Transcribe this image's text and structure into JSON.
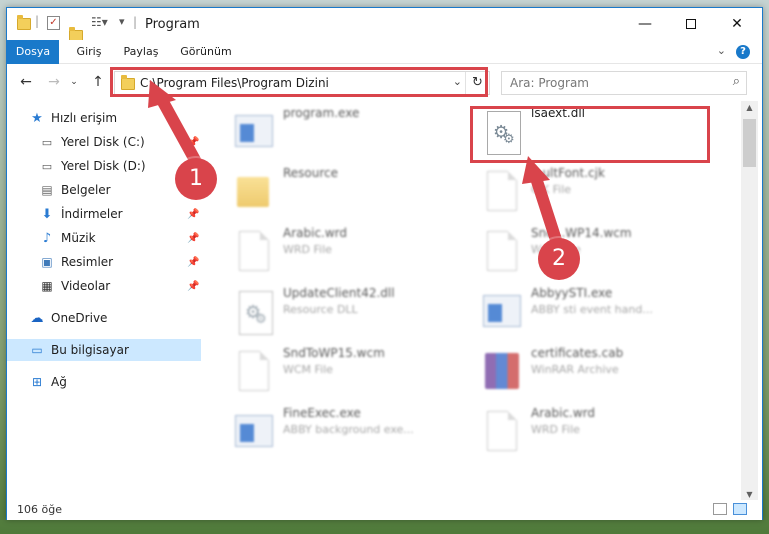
{
  "window": {
    "title": "Program",
    "minimize_icon": "minimize-icon",
    "maximize_icon": "maximize-icon",
    "close_icon": "close-icon"
  },
  "ribbon": {
    "tabs": [
      {
        "label": "Dosya",
        "active": true
      },
      {
        "label": "Giriş"
      },
      {
        "label": "Paylaş"
      },
      {
        "label": "Görünüm"
      }
    ],
    "help": "?"
  },
  "address": {
    "path": "C:\\Program Files\\Program Dizini",
    "search_placeholder": "Ara: Program"
  },
  "sidebar": {
    "items": [
      {
        "label": "Hızlı erişim",
        "icon": "star-icon"
      },
      {
        "label": "Yerel Disk (C:)",
        "icon": "drive-icon",
        "pinned": true
      },
      {
        "label": "Yerel Disk (D:)",
        "icon": "drive-icon"
      },
      {
        "label": "Belgeler",
        "icon": "documents-icon"
      },
      {
        "label": "İndirmeler",
        "icon": "download-icon",
        "pinned": true
      },
      {
        "label": "Müzik",
        "icon": "music-icon",
        "pinned": true
      },
      {
        "label": "Resimler",
        "icon": "pictures-icon",
        "pinned": true
      },
      {
        "label": "Videolar",
        "icon": "videos-icon",
        "pinned": true
      },
      {
        "label": "OneDrive",
        "icon": "cloud-icon"
      },
      {
        "label": "Bu bilgisayar",
        "icon": "computer-icon",
        "selected": true
      },
      {
        "label": "Ağ",
        "icon": "network-icon"
      }
    ]
  },
  "files": [
    {
      "name": "program.exe",
      "type": "",
      "icon": "application-icon"
    },
    {
      "name": "lsaext.dll",
      "type": "",
      "icon": "dll-gear-icon"
    },
    {
      "name": "Resource",
      "type": "",
      "icon": "folder-icon"
    },
    {
      "name": "...ultFont.cjk",
      "type": "CJK File",
      "icon": "file-icon"
    },
    {
      "name": "Arabic.wrd",
      "type": "WRD File",
      "icon": "file-icon"
    },
    {
      "name": "Snd...WP14.wcm",
      "type": "WCM File",
      "icon": "file-icon"
    },
    {
      "name": "UpdateClient42.dll",
      "type": "Resource DLL",
      "icon": "dll-gear-icon"
    },
    {
      "name": "AbbyySTI.exe",
      "type": "ABBY sti event hand...",
      "icon": "application-icon"
    },
    {
      "name": "SndToWP15.wcm",
      "type": "WCM File",
      "icon": "file-icon"
    },
    {
      "name": "certificates.cab",
      "type": "WinRAR Archive",
      "icon": "archive-icon"
    },
    {
      "name": "FineExec.exe",
      "type": "ABBY background exe...",
      "icon": "application-icon"
    },
    {
      "name": "Arabic.wrd",
      "type": "WRD File",
      "icon": "file-icon"
    }
  ],
  "callouts": [
    "1",
    "2"
  ],
  "status": {
    "count": "106 öğe"
  },
  "colors": {
    "accent": "#1979ca",
    "highlight": "#d9444b",
    "selection": "#cce8ff"
  }
}
